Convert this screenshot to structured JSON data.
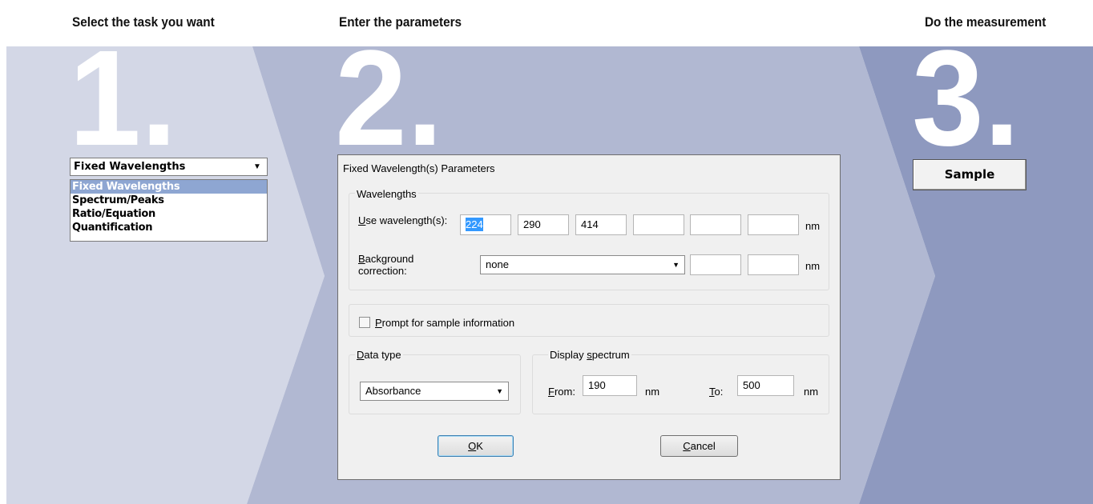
{
  "steps": [
    {
      "heading": "Select the task you want",
      "number": "1."
    },
    {
      "heading": "Enter the parameters",
      "number": "2."
    },
    {
      "heading": "Do the measurement",
      "number": "3."
    }
  ],
  "task_select": {
    "selected": "Fixed Wavelengths",
    "options": [
      "Fixed Wavelengths",
      "Spectrum/Peaks",
      "Ratio/Equation",
      "Quantification"
    ]
  },
  "dialog": {
    "title": "Fixed Wavelength(s) Parameters",
    "wavelengths_group": "Wavelengths",
    "use_wavelengths_label_accel": "U",
    "use_wavelengths_label_rest": "se wavelength(s):",
    "wavelength_values": [
      "224",
      "290",
      "414",
      "",
      "",
      ""
    ],
    "unit": "nm",
    "background_label_accel": "B",
    "background_label_rest1": "ackground",
    "background_label_line2": "correction:",
    "background_value": "none",
    "prompt_accel": "P",
    "prompt_rest": "rompt for sample information",
    "data_type_accel": "D",
    "data_type_rest": "ata type",
    "data_type_value": "Absorbance",
    "display_prefix": "Display ",
    "display_accel": "s",
    "display_rest": "pectrum",
    "from_accel": "F",
    "from_rest": "rom:",
    "from_value": "190",
    "to_accel": "T",
    "to_rest": "o:",
    "to_value": "500",
    "ok_accel": "O",
    "ok_rest": "K",
    "cancel_accel": "C",
    "cancel_rest": "ancel"
  },
  "sample_button": "Sample",
  "colors": {
    "panel1": "#d3d7e6",
    "panel2": "#b1b8d2",
    "panel3": "#8e99bf"
  }
}
